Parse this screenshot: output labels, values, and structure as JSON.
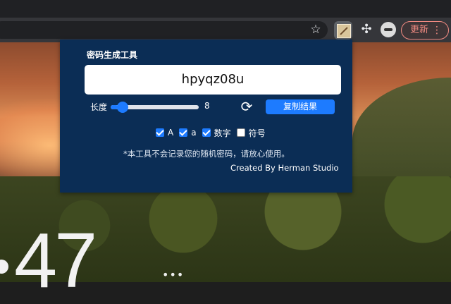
{
  "browser": {
    "update_label": "更新",
    "star_icon": "star-icon",
    "extensions_icon": "puzzle-icon"
  },
  "popup": {
    "title": "密码生成工具",
    "password": "hpyqz08u",
    "length_label": "长度",
    "length_value": "8",
    "length_fraction": 0.09,
    "copy_label": "复制结果",
    "options": [
      {
        "label": "A",
        "checked": true
      },
      {
        "label": "a",
        "checked": true
      },
      {
        "label": "数字",
        "checked": true
      },
      {
        "label": "符号",
        "checked": false
      }
    ],
    "note": "*本工具不会记录您的随机密码，请放心使用。",
    "credit": "Created By Herman Studio"
  },
  "background": {
    "clock_text": "47",
    "more_dots": "•••"
  },
  "colors": {
    "popup_bg": "#0b2d55",
    "accent": "#1d7bff",
    "update_red": "#f28b82"
  }
}
